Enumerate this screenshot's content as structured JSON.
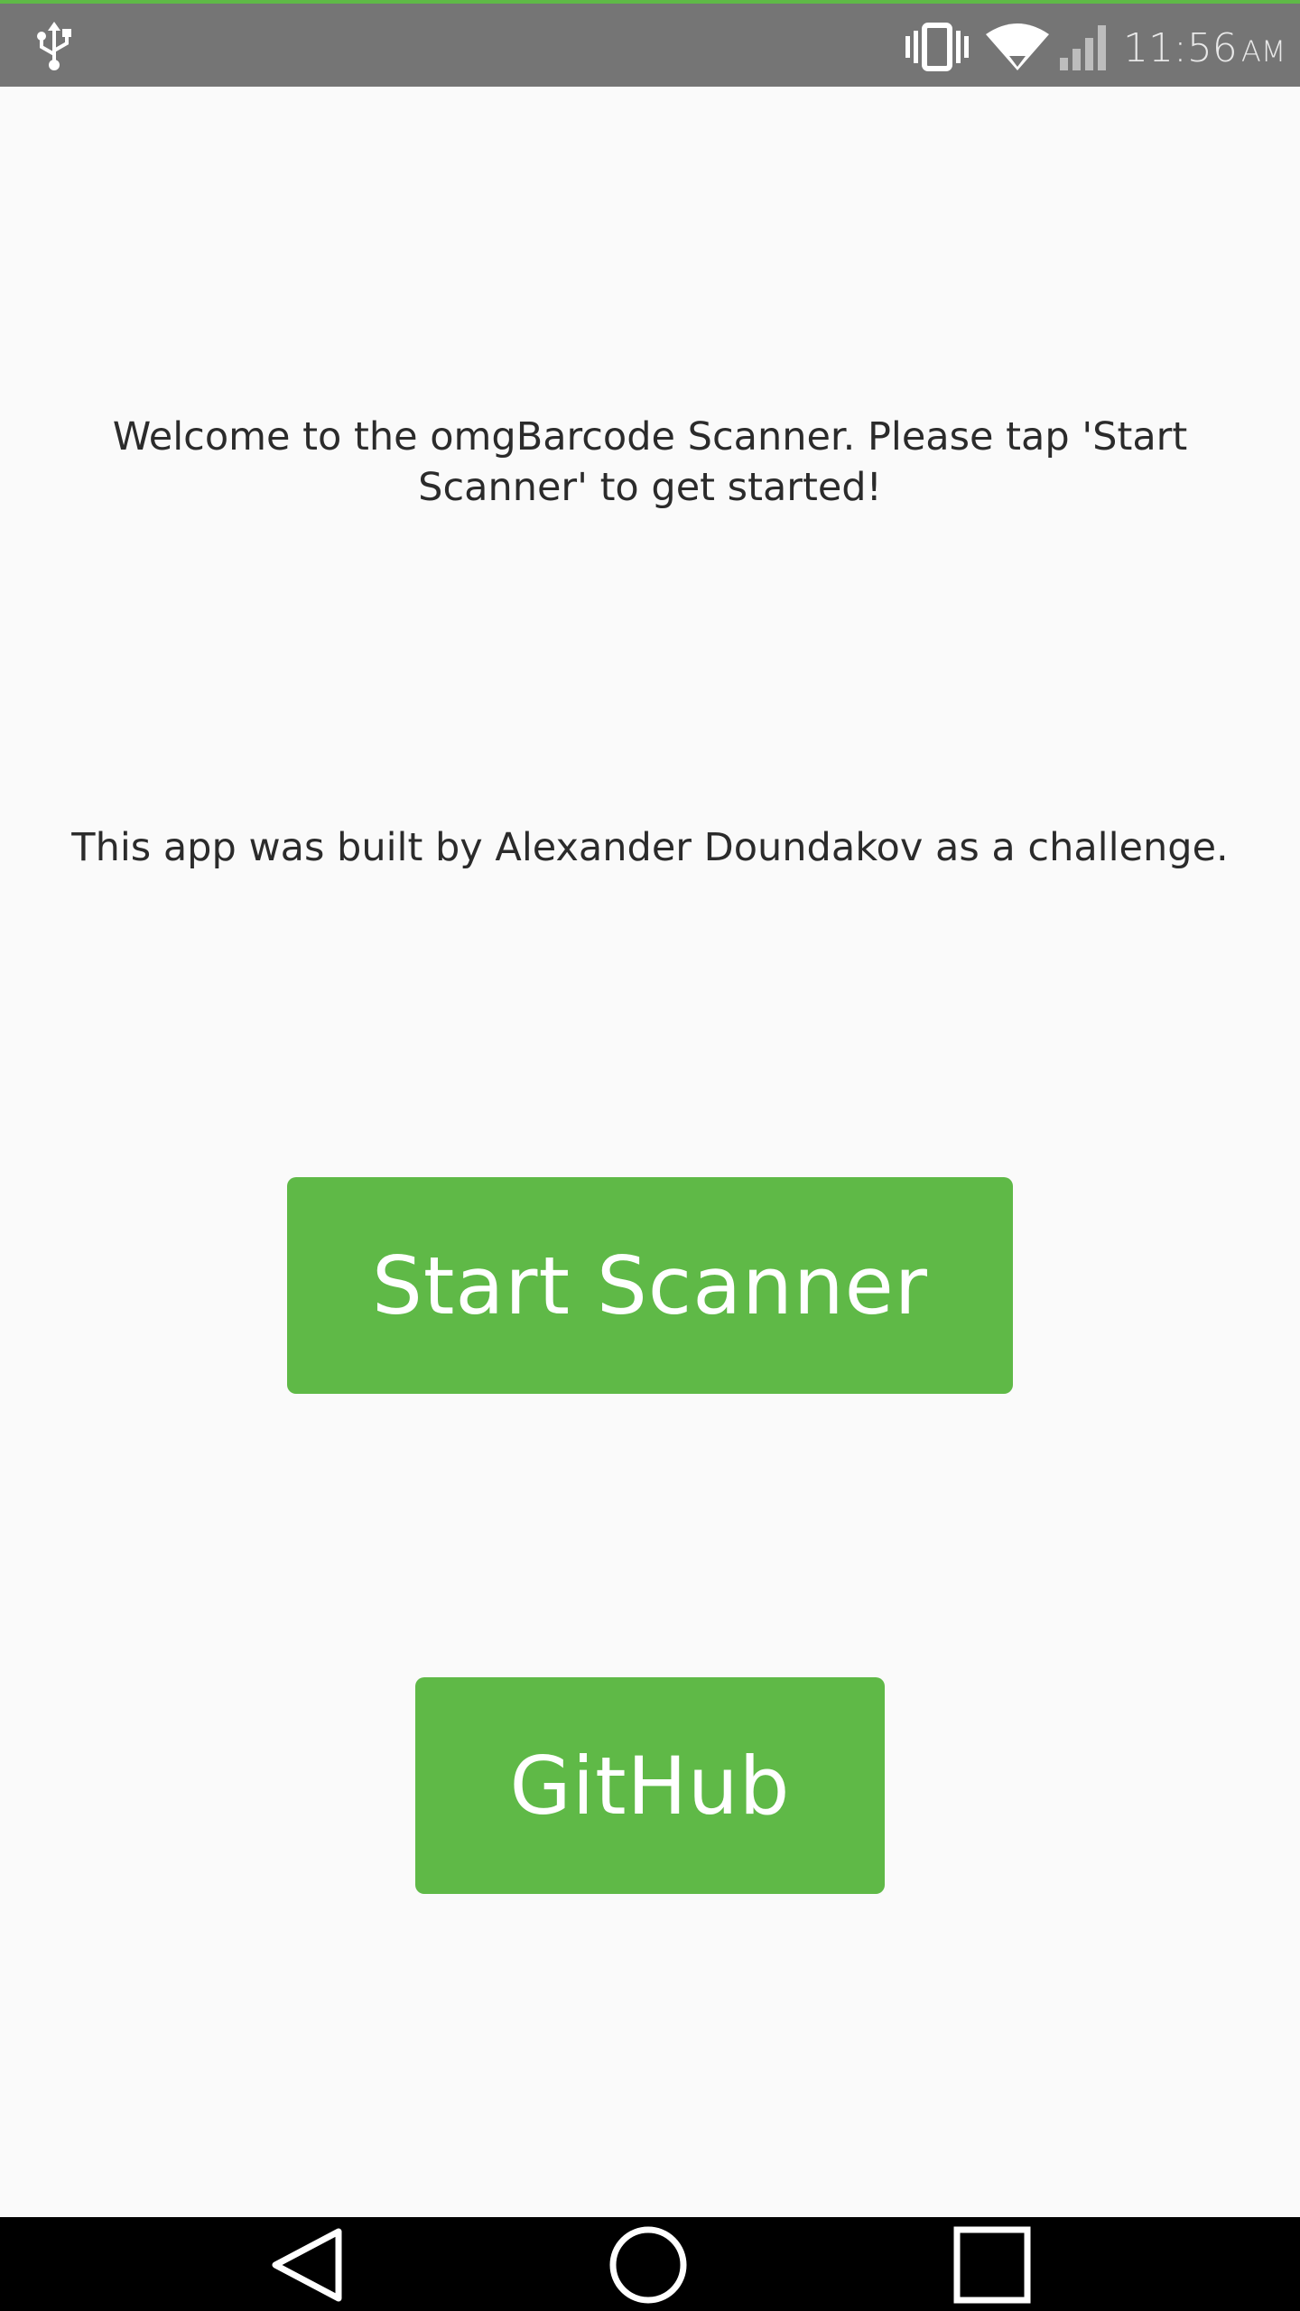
{
  "status_bar": {
    "time": "11:56",
    "ampm": "AM",
    "icons": [
      "usb-icon",
      "vibrate-icon",
      "wifi-icon",
      "signal-icon"
    ],
    "background_color": "#757575",
    "accent_line_color": "#5fb947"
  },
  "main": {
    "welcome_text": "Welcome to the omgBarcode Scanner. Please tap 'Start Scanner' to get started!",
    "credit_text": "This app was built by Alexander Doundakov as a challenge.",
    "start_button_label": "Start Scanner",
    "github_button_label": "GitHub",
    "button_color": "#5fb947",
    "background_color": "#fafafa"
  },
  "nav_bar": {
    "icons": [
      "back-icon",
      "home-icon",
      "recents-icon"
    ],
    "background_color": "#000000"
  }
}
